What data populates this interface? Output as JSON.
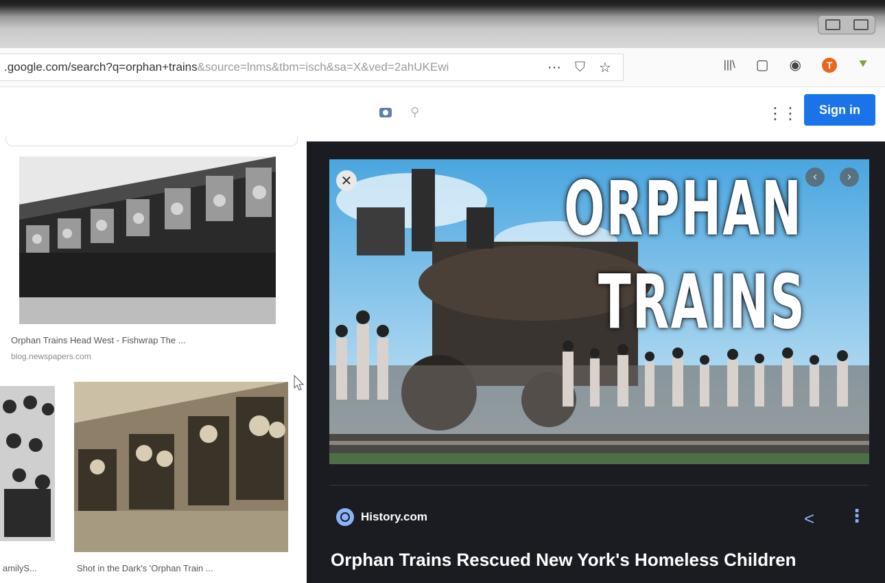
{
  "browser": {
    "url_main": ".google.com/search?q=orphan+trains",
    "url_rest": "&source=lnms&tbm=isch&sa=X&ved=2ahUKEwi",
    "url_actions": [
      "···",
      "⛉",
      "☆"
    ],
    "right_icons": [
      "|||\\",
      "▢",
      "◉",
      "T",
      "⯆"
    ]
  },
  "google": {
    "sign_in_label": "Sign in",
    "apps_glyph": "⋮⋮⋮"
  },
  "results": [
    {
      "title": "Orphan Trains Head West - Fishwrap The ...",
      "source": "blog.newspapers.com"
    },
    {
      "title": "amilyS...",
      "source": ""
    },
    {
      "title": "Shot in the Dark's 'Orphan Train ...",
      "source": ""
    }
  ],
  "preview": {
    "hero_line1": "ORPHAN",
    "hero_line2": "TRAINS",
    "source_name": "History.com",
    "title": "Orphan Trains Rescued New York's Homeless Children",
    "close_glyph": "✕",
    "prev_glyph": "‹",
    "next_glyph": "›",
    "share_glyph": "<",
    "more_glyph": "⋮"
  },
  "colors": {
    "accent": "#1a73e8",
    "panel_bg": "#1b1b22",
    "link_blue": "#8ab4f8"
  }
}
